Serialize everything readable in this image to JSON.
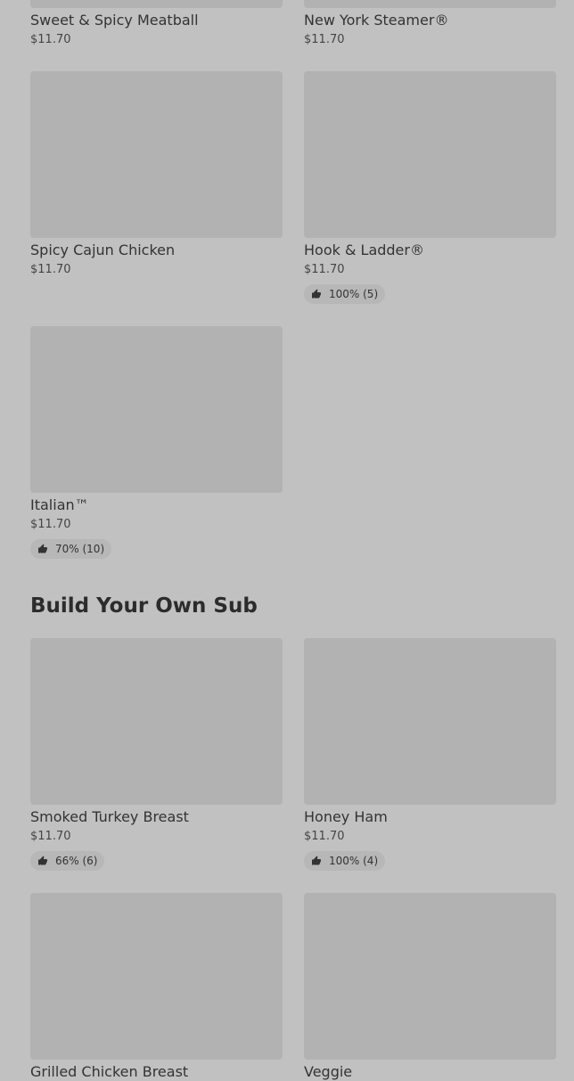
{
  "items": [
    {
      "name": "Sweet & Spicy Meatball",
      "price": "$11.70"
    },
    {
      "name": "New York Steamer®",
      "price": "$11.70"
    },
    {
      "name": "Spicy Cajun Chicken",
      "price": "$11.70"
    },
    {
      "name": "Hook & Ladder®",
      "price": "$11.70",
      "rating": "100% (5)"
    },
    {
      "name": "Italian™",
      "price": "$11.70",
      "rating": "70% (10)"
    }
  ],
  "build_section": {
    "title": "Build Your Own Sub",
    "items": [
      {
        "name": "Smoked Turkey Breast",
        "price": "$11.70",
        "rating": "66% (6)"
      },
      {
        "name": "Honey Ham",
        "price": "$11.70",
        "rating": "100% (4)"
      },
      {
        "name": "Grilled Chicken Breast"
      },
      {
        "name": "Veggie"
      }
    ]
  },
  "icons": {
    "rating": "thumbs-up-icon"
  },
  "colors": {
    "background": "#c1c1c1",
    "image_placeholder": "#b2b2b2"
  }
}
